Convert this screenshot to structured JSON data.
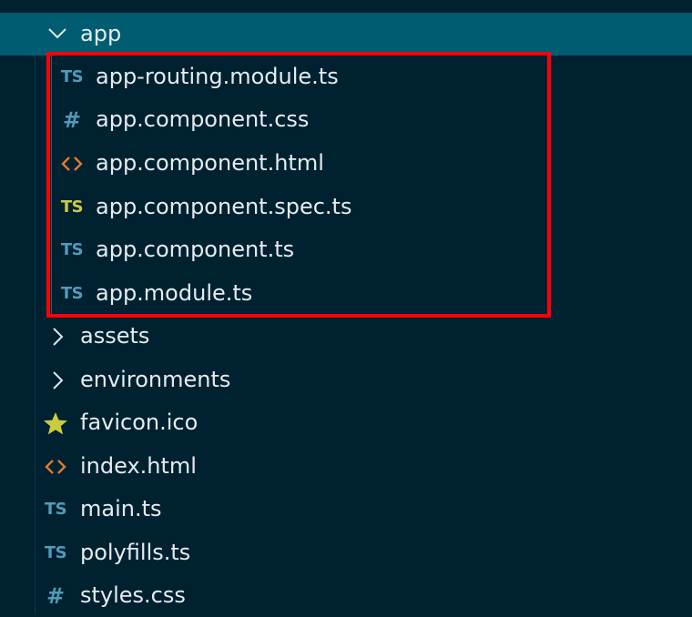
{
  "colors": {
    "background": "#002130",
    "selected_row": "#005d71",
    "highlight_border": "#ff0008",
    "ts_icon": "#519aba",
    "spec_icon": "#cbcb41",
    "css_icon": "#519aba",
    "html_icon": "#e37933",
    "favicon_icon": "#cbcb41",
    "text": "#e4ecf0"
  },
  "tree": {
    "app_folder": {
      "label": "app",
      "icon": "chevron-down-icon",
      "expanded": true
    },
    "app_children": [
      {
        "label": "app-routing.module.ts",
        "icon": "typescript-icon",
        "glyph": "TS"
      },
      {
        "label": "app.component.css",
        "icon": "css-icon",
        "glyph": "#"
      },
      {
        "label": "app.component.html",
        "icon": "html-icon",
        "glyph": "<>"
      },
      {
        "label": "app.component.spec.ts",
        "icon": "typescript-spec-icon",
        "glyph": "TS"
      },
      {
        "label": "app.component.ts",
        "icon": "typescript-icon",
        "glyph": "TS"
      },
      {
        "label": "app.module.ts",
        "icon": "typescript-icon",
        "glyph": "TS"
      }
    ],
    "src_items": [
      {
        "label": "assets",
        "icon": "chevron-right-icon",
        "kind": "folder"
      },
      {
        "label": "environments",
        "icon": "chevron-right-icon",
        "kind": "folder"
      },
      {
        "label": "favicon.ico",
        "icon": "star-icon",
        "kind": "file"
      },
      {
        "label": "index.html",
        "icon": "html-icon",
        "kind": "file",
        "glyph": "<>"
      },
      {
        "label": "main.ts",
        "icon": "typescript-icon",
        "kind": "file",
        "glyph": "TS"
      },
      {
        "label": "polyfills.ts",
        "icon": "typescript-icon",
        "kind": "file",
        "glyph": "TS"
      },
      {
        "label": "styles.css",
        "icon": "css-icon",
        "kind": "file",
        "glyph": "#"
      }
    ]
  }
}
